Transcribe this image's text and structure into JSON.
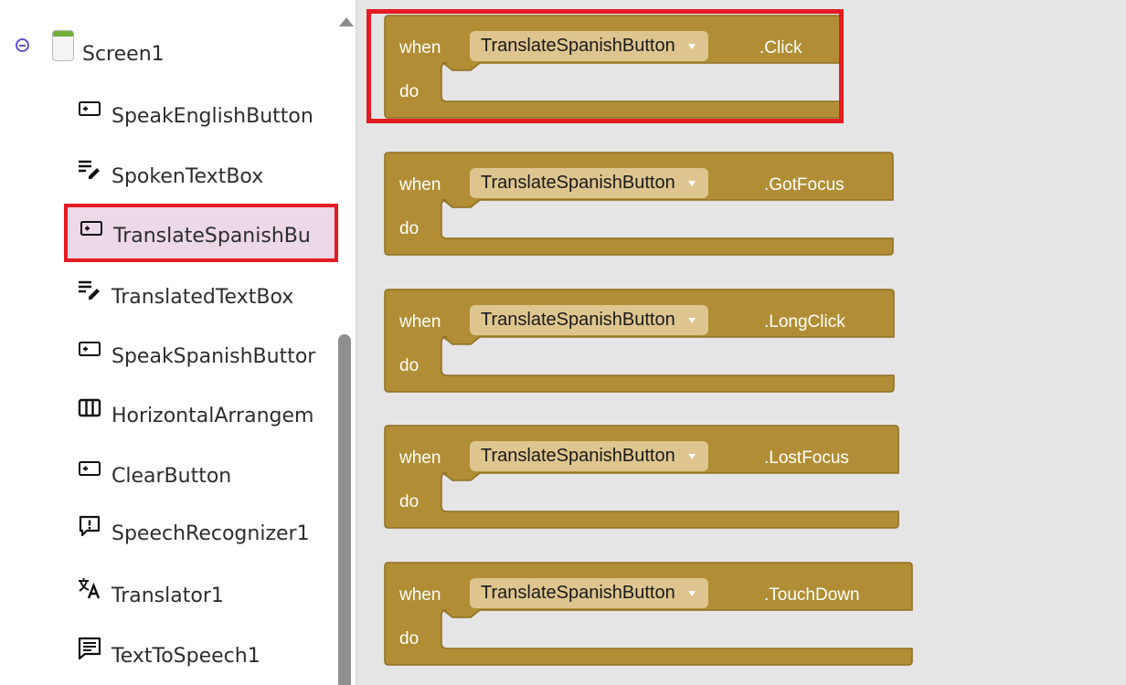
{
  "tree": {
    "root_label": "Screen1",
    "items": [
      {
        "label": "SpeakEnglishButton",
        "icon": "button-icon"
      },
      {
        "label": "SpokenTextBox",
        "icon": "textbox-icon"
      },
      {
        "label": "TranslateSpanishBu",
        "icon": "button-icon",
        "selected": true
      },
      {
        "label": "TranslatedTextBox",
        "icon": "textbox-icon"
      },
      {
        "label": "SpeakSpanishButtor",
        "icon": "button-icon"
      },
      {
        "label": "HorizontalArrangem",
        "icon": "horizontal-arrangement-icon"
      },
      {
        "label": "ClearButton",
        "icon": "button-icon"
      },
      {
        "label": "SpeechRecognizer1",
        "icon": "speech-recognizer-icon"
      },
      {
        "label": "Translator1",
        "icon": "translator-icon"
      },
      {
        "label": "TextToSpeech1",
        "icon": "text-to-speech-icon"
      }
    ]
  },
  "workspace": {
    "blocks": [
      {
        "when": "when",
        "component": "TranslateSpanishButton",
        "event": ".Click",
        "do": "do",
        "highlighted": true
      },
      {
        "when": "when",
        "component": "TranslateSpanishButton",
        "event": ".GotFocus",
        "do": "do"
      },
      {
        "when": "when",
        "component": "TranslateSpanishButton",
        "event": ".LongClick",
        "do": "do"
      },
      {
        "when": "when",
        "component": "TranslateSpanishButton",
        "event": ".LostFocus",
        "do": "do"
      },
      {
        "when": "when",
        "component": "TranslateSpanishButton",
        "event": ".TouchDown",
        "do": "do"
      }
    ]
  },
  "colors": {
    "block": "#b18e35",
    "block_dark": "#8f6f22",
    "dropdown": "#dec58f",
    "highlight": "#e41b23",
    "selected_item": "#ecd8e7",
    "workspace": "#e5e5e5",
    "collapse_icon": "#5a55c9"
  }
}
